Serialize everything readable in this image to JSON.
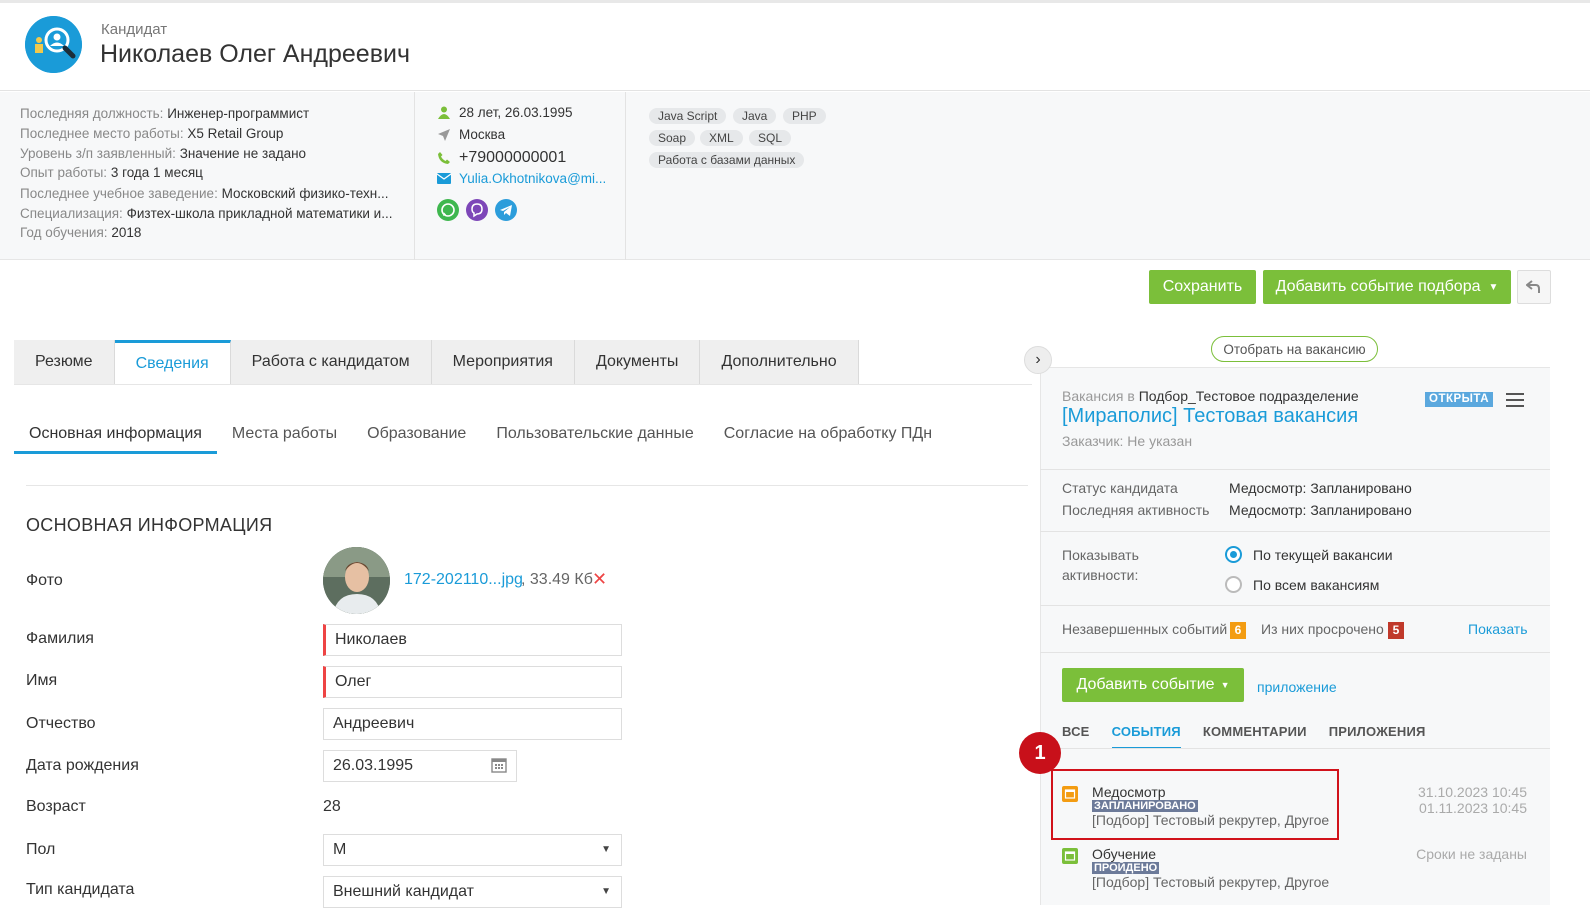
{
  "header": {
    "caption": "Кандидат",
    "name": "Николаев Олег Андреевич"
  },
  "info": {
    "rows": [
      {
        "k": "Последняя должность:",
        "v": "Инженер-программист"
      },
      {
        "k": "Последнее место работы:",
        "v": "X5 Retail Group"
      },
      {
        "k": "Уровень з/п заявленный:",
        "v": "Значение не задано"
      },
      {
        "k": "Опыт работы:",
        "v": "3 года 1 месяц"
      },
      {
        "k": "Последнее учебное заведение:",
        "v": "Московский физико-техн..."
      },
      {
        "k": "Специализация:",
        "v": "Физтех-школа прикладной математики и..."
      },
      {
        "k": "Год обучения:",
        "v": "2018"
      }
    ],
    "age": "28 лет, 26.03.1995",
    "city": "Москва",
    "phone": "+79000000001",
    "email": "Yulia.Okhotnikova@mi...",
    "messengers": [
      "whatsapp-icon",
      "viber-icon",
      "telegram-icon"
    ],
    "tags": [
      "Java Script",
      "Java",
      "PHP",
      "Soap",
      "XML",
      "SQL",
      "Работа с базами данных"
    ]
  },
  "actions": {
    "save": "Сохранить",
    "add_selection_event": "Добавить событие подбора"
  },
  "tabs": [
    "Резюме",
    "Сведения",
    "Работа с кандидатом",
    "Мероприятия",
    "Документы",
    "Дополнительно"
  ],
  "subtabs": [
    "Основная информация",
    "Места работы",
    "Образование",
    "Пользовательские данные",
    "Согласие на обработку ПДн"
  ],
  "form": {
    "section_title": "ОСНОВНАЯ ИНФОРМАЦИЯ",
    "photo_label": "Фото",
    "photo_file": "172-202110...jpg",
    "photo_size": ", 33.49 Кб",
    "fields": {
      "lastname": {
        "label": "Фамилия",
        "value": "Николаев"
      },
      "firstname": {
        "label": "Имя",
        "value": "Олег"
      },
      "middlename": {
        "label": "Отчество",
        "value": "Андреевич"
      },
      "birthdate": {
        "label": "Дата рождения",
        "value": "26.03.1995"
      },
      "age": {
        "label": "Возраст",
        "value": "28"
      },
      "gender": {
        "label": "Пол",
        "value": "М"
      },
      "type": {
        "label": "Тип кандидата",
        "value": "Внешний кандидат"
      }
    }
  },
  "panel": {
    "pick_button": "Отобрать на вакансию",
    "vacancy_in": "Вакансия в",
    "vacancy_dept": "Подбор_Тестовое подразделение",
    "vacancy_title": "[Мираполис] Тестовая вакансия",
    "customer": "Заказчик: Не указан",
    "status_badge": "ОТКРЫТА",
    "status_label": "Статус кандидата",
    "status_value": "Медосмотр: Запланировано",
    "last_label": "Последняя активность",
    "last_value": "Медосмотр: Запланировано",
    "show_label_1": "Показывать",
    "show_label_2": "активности:",
    "radio_current": "По текущей вакансии",
    "radio_all": "По всем вакансиям",
    "unfinished_label": "Незавершенных событий",
    "unfinished_count": "6",
    "overdue_label": "Из них просрочено",
    "overdue_count": "5",
    "show_link": "Показать",
    "add_event": "Добавить событие",
    "attachment_link": "приложение",
    "event_tabs": [
      "ВСЕ",
      "СОБЫТИЯ",
      "КОММЕНТАРИИ",
      "ПРИЛОЖЕНИЯ"
    ],
    "events": [
      {
        "title": "Медосмотр",
        "status": "ЗАПЛАНИРОВАНО",
        "sub": "[Подбор] Тестовый рекрутер, Другое",
        "date1": "31.10.2023 10:45",
        "date2": "01.11.2023 10:45"
      },
      {
        "title": "Обучение",
        "status": "ПРОЙДЕНО",
        "sub": "[Подбор] Тестовый рекрутер, Другое",
        "date1": "Сроки не заданы",
        "date2": ""
      }
    ],
    "highlight_number": "1"
  },
  "colors": {
    "accent": "#1a9bd8",
    "green": "#7bbf3a",
    "highlight": "#d1121b"
  }
}
